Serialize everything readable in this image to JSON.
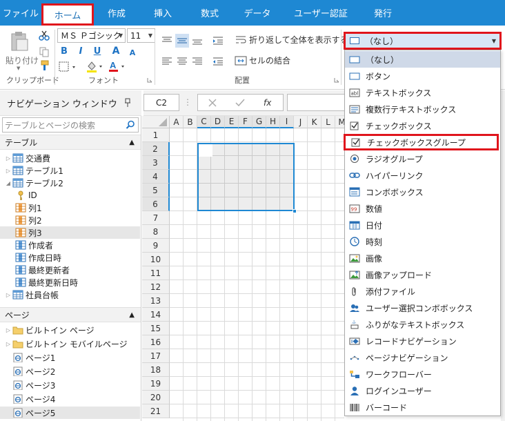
{
  "tabs": [
    {
      "label": "ファイル",
      "active": false
    },
    {
      "label": "ホーム",
      "active": true
    },
    {
      "label": "作成",
      "active": false
    },
    {
      "label": "挿入",
      "active": false
    },
    {
      "label": "数式",
      "active": false
    },
    {
      "label": "データ",
      "active": false
    },
    {
      "label": "ユーザー認証",
      "active": false
    },
    {
      "label": "発行",
      "active": false
    }
  ],
  "ribbon": {
    "clipboard": {
      "paste_label": "貼り付け",
      "group_label": "クリップボード"
    },
    "font": {
      "name": "ＭＳ Ｐゴシック",
      "size": "11",
      "group_label": "フォント",
      "bold": "B",
      "italic": "I",
      "underline": "U",
      "grow": "A",
      "shrink": "A"
    },
    "alignment": {
      "wrap_label": "折り返して全体を表示する",
      "merge_label": "セルの結合",
      "group_label": "配置"
    },
    "field_type": {
      "selected": "（なし）"
    }
  },
  "nav": {
    "title": "ナビゲーション ウィンドウ",
    "search_placeholder": "テーブルとページの検索",
    "tables_header": "テーブル",
    "tables": [
      {
        "label": "交通費",
        "expanded": false,
        "depth": 0
      },
      {
        "label": "テーブル1",
        "expanded": false,
        "depth": 0
      },
      {
        "label": "テーブル2",
        "expanded": true,
        "depth": 0
      },
      {
        "label": "ID",
        "depth": 1,
        "kind": "key"
      },
      {
        "label": "列1",
        "depth": 1,
        "kind": "col"
      },
      {
        "label": "列2",
        "depth": 1,
        "kind": "col"
      },
      {
        "label": "列3",
        "depth": 1,
        "kind": "col",
        "selected": true
      },
      {
        "label": "作成者",
        "depth": 1,
        "kind": "sys"
      },
      {
        "label": "作成日時",
        "depth": 1,
        "kind": "sys"
      },
      {
        "label": "最終更新者",
        "depth": 1,
        "kind": "sys"
      },
      {
        "label": "最終更新日時",
        "depth": 1,
        "kind": "sys"
      },
      {
        "label": "社員台帳",
        "expanded": false,
        "depth": 0
      }
    ],
    "pages_header": "ページ",
    "pages": [
      {
        "label": "ビルトイン ページ",
        "kind": "folder"
      },
      {
        "label": "ビルトイン モバイルページ",
        "kind": "folder"
      },
      {
        "label": "ページ1",
        "kind": "page"
      },
      {
        "label": "ページ2",
        "kind": "page"
      },
      {
        "label": "ページ3",
        "kind": "page"
      },
      {
        "label": "ページ4",
        "kind": "page"
      },
      {
        "label": "ページ5",
        "kind": "page",
        "selected": true
      }
    ]
  },
  "formula": {
    "cell_ref": "C2",
    "fx": "fx"
  },
  "grid": {
    "columns": [
      "A",
      "B",
      "C",
      "D",
      "E",
      "F",
      "G",
      "H",
      "I",
      "J",
      "K",
      "L",
      "M"
    ],
    "rows": [
      "1",
      "2",
      "3",
      "4",
      "5",
      "6",
      "7",
      "8",
      "9",
      "10",
      "11",
      "12",
      "13",
      "14",
      "15",
      "16",
      "17",
      "18",
      "19",
      "20",
      "21"
    ]
  },
  "dropdown": {
    "items": [
      {
        "label": "（なし）",
        "icon": "none-icon",
        "highlighted": true
      },
      {
        "label": "ボタン",
        "icon": "button-icon"
      },
      {
        "label": "テキストボックス",
        "icon": "textbox-icon"
      },
      {
        "label": "複数行テキストボックス",
        "icon": "multiline-textbox-icon"
      },
      {
        "label": "チェックボックス",
        "icon": "checkbox-icon"
      },
      {
        "label": "チェックボックスグループ",
        "icon": "checkbox-group-icon",
        "boxed": true
      },
      {
        "label": "ラジオグループ",
        "icon": "radio-group-icon"
      },
      {
        "label": "ハイパーリンク",
        "icon": "hyperlink-icon"
      },
      {
        "label": "コンボボックス",
        "icon": "combobox-icon"
      },
      {
        "label": "数値",
        "icon": "number-icon"
      },
      {
        "label": "日付",
        "icon": "date-icon"
      },
      {
        "label": "時刻",
        "icon": "time-icon"
      },
      {
        "label": "画像",
        "icon": "image-icon"
      },
      {
        "label": "画像アップロード",
        "icon": "image-upload-icon"
      },
      {
        "label": "添付ファイル",
        "icon": "attachment-icon"
      },
      {
        "label": "ユーザー選択コンボボックス",
        "icon": "user-select-icon"
      },
      {
        "label": "ふりがなテキストボックス",
        "icon": "furigana-icon"
      },
      {
        "label": "レコードナビゲーション",
        "icon": "record-nav-icon"
      },
      {
        "label": "ページナビゲーション",
        "icon": "page-nav-icon"
      },
      {
        "label": "ワークフローバー",
        "icon": "workflow-icon"
      },
      {
        "label": "ログインユーザー",
        "icon": "login-user-icon"
      },
      {
        "label": "バーコード",
        "icon": "barcode-icon"
      }
    ]
  },
  "colors": {
    "accent": "#1e88d3",
    "highlight_border": "#e0151c"
  }
}
